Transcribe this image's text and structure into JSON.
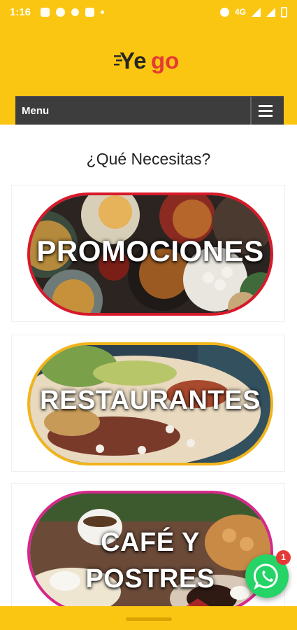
{
  "status_bar": {
    "time": "1:16",
    "network": "4G"
  },
  "brand": {
    "logo_text_prefix": "Ye",
    "logo_text_suffix": "go",
    "yellow": "#FBC611",
    "red": "#E53935"
  },
  "nav": {
    "menu_label": "Menu",
    "hamburger_icon": "hamburger-icon"
  },
  "main": {
    "question": "¿Qué Necesitas?",
    "categories": [
      {
        "label": "PROMOCIONES",
        "border_color": "#D7192A"
      },
      {
        "label": "RESTAURANTES",
        "border_color": "#F2B41C"
      },
      {
        "label_line1": "CAFÉ Y",
        "label_line2": "POSTRES",
        "border_color": "#D6288C"
      }
    ]
  },
  "whatsapp": {
    "icon": "whatsapp-icon",
    "badge_count": "1"
  }
}
